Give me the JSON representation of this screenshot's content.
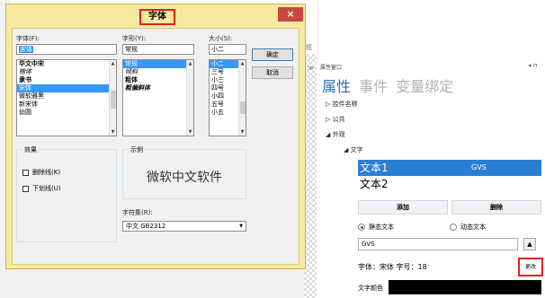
{
  "dialog": {
    "title": "字体",
    "close_glyph": "×",
    "font_label": "字体(F):",
    "font_value": "宋体",
    "font_list": [
      "华文中宋",
      "楷体",
      "隶书",
      "宋体",
      "微软雅黑",
      "新宋体",
      "幼圆"
    ],
    "style_label": "字形(Y):",
    "style_value": "常规",
    "style_list": [
      "常规",
      "倾斜",
      "粗体",
      "粗偏斜体"
    ],
    "size_label": "大小(S):",
    "size_value": "小二",
    "size_list": [
      "小二",
      "三号",
      "小三",
      "四号",
      "小四",
      "五号",
      "小五"
    ],
    "ok_label": "确定",
    "cancel_label": "取消",
    "effects_label": "效果",
    "strike_label": "删除线(K)",
    "underline_label": "下划线(U)",
    "sample_label": "示例",
    "sample_text": "微软中文软件",
    "charset_label": "字符集(R):",
    "charset_value": "中文 GB2312"
  },
  "panel": {
    "window_title": "属性窗口",
    "pin_glyph": "▾ ⊓",
    "tabs": [
      "属性",
      "事件",
      "变量绑定"
    ],
    "tree": {
      "control_name": "▷ 控件名称",
      "public": "▷ 公共",
      "appearance": "◢ 外观",
      "text": "◢ 文字"
    },
    "list_items": [
      {
        "label": "文本1",
        "extra": "GVS"
      },
      {
        "label": "文本2",
        "extra": ""
      }
    ],
    "add_label": "添加",
    "delete_label": "删除",
    "static_text_label": "静态文本",
    "dynamic_text_label": "动态文本",
    "variable_value": "GVS",
    "up_glyph": "▲",
    "font_info": "字体：宋体   字号：18",
    "change_label": "更改",
    "text_color_label": "文字颜色",
    "text_color": "#000000"
  },
  "side": {
    "char_a": "框",
    "char_b": "≫"
  }
}
